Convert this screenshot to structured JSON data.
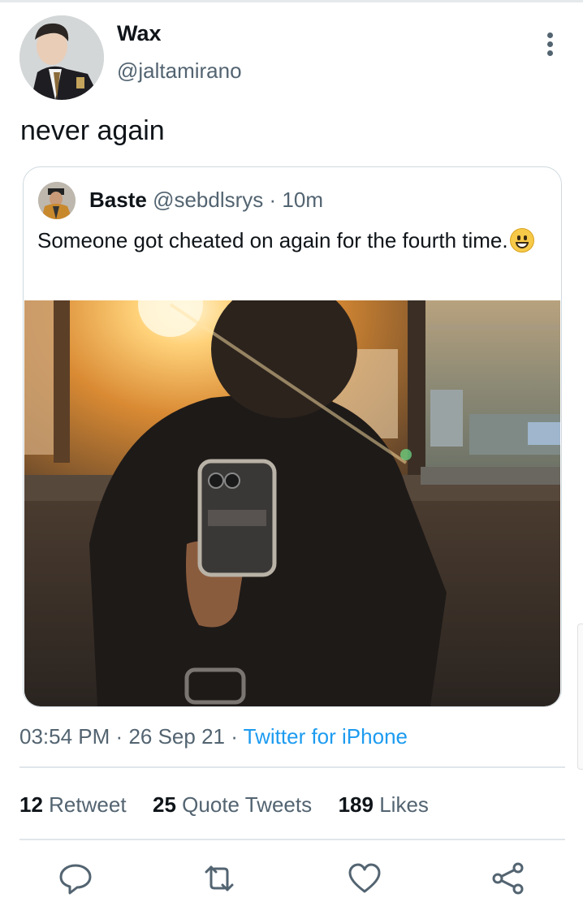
{
  "tweet": {
    "author": {
      "display_name": "Wax",
      "handle": "@jaltamirano",
      "avatar_icon": "profile-photo"
    },
    "text": "never again",
    "more_icon": "more-vertical-icon",
    "timestamp": "03:54 PM",
    "separator": "·",
    "date": "26 Sep 21",
    "source": "Twitter for iPhone"
  },
  "quoted_tweet": {
    "display_name": "Baste",
    "handle": "@sebdlsrys",
    "separator": "·",
    "time_ago": "10m",
    "text": "Someone got cheated on again for the fourth time.",
    "emoji": "grinning-face-emoji",
    "media": "photo-sunlit-mirror-selfie"
  },
  "stats": {
    "retweets_count": "12",
    "retweets_label": "Retweet",
    "quotes_count": "25",
    "quotes_label": "Quote Tweets",
    "likes_count": "189",
    "likes_label": "Likes"
  },
  "actions": [
    "reply-icon",
    "retweet-icon",
    "like-icon",
    "share-icon"
  ],
  "colors": {
    "link": "#1d9bf0",
    "secondary_text": "#536471",
    "primary_text": "#0f1419",
    "border": "#cfd9de"
  }
}
